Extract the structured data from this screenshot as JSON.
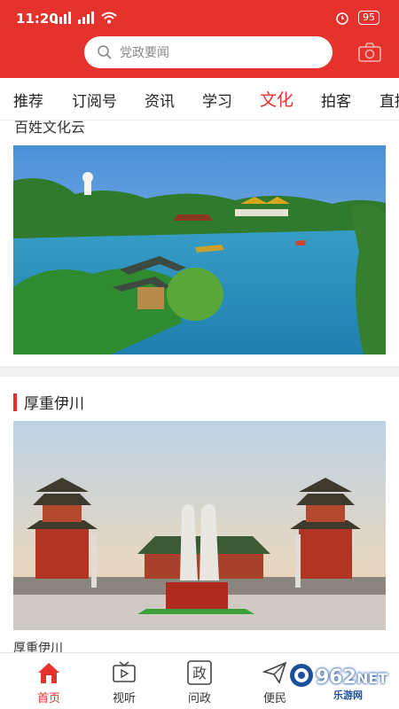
{
  "status_bar": {
    "time": "11:20",
    "signal": [
      "5G",
      "4G"
    ],
    "battery": "95"
  },
  "search": {
    "placeholder": "党政要闻"
  },
  "tabs": [
    {
      "label": "推荐"
    },
    {
      "label": "订阅号"
    },
    {
      "label": "资讯"
    },
    {
      "label": "学习"
    },
    {
      "label": "文化",
      "active": true
    },
    {
      "label": "拍客"
    },
    {
      "label": "直播"
    }
  ],
  "feed": {
    "cut_title": "百姓文化云",
    "section_title": "厚重伊川",
    "caption": "厚重伊川"
  },
  "bottom_nav": [
    {
      "label": "首页",
      "icon": "home-icon",
      "active": true
    },
    {
      "label": "视听",
      "icon": "tv-icon"
    },
    {
      "label": "问政",
      "icon": "zheng-icon",
      "glyph": "政"
    },
    {
      "label": "便民",
      "icon": "paper-plane-icon"
    }
  ],
  "watermark": {
    "brand": "962",
    "suffix": "NET",
    "sub": "乐游网"
  },
  "colors": {
    "brand_red": "#e5322d"
  }
}
